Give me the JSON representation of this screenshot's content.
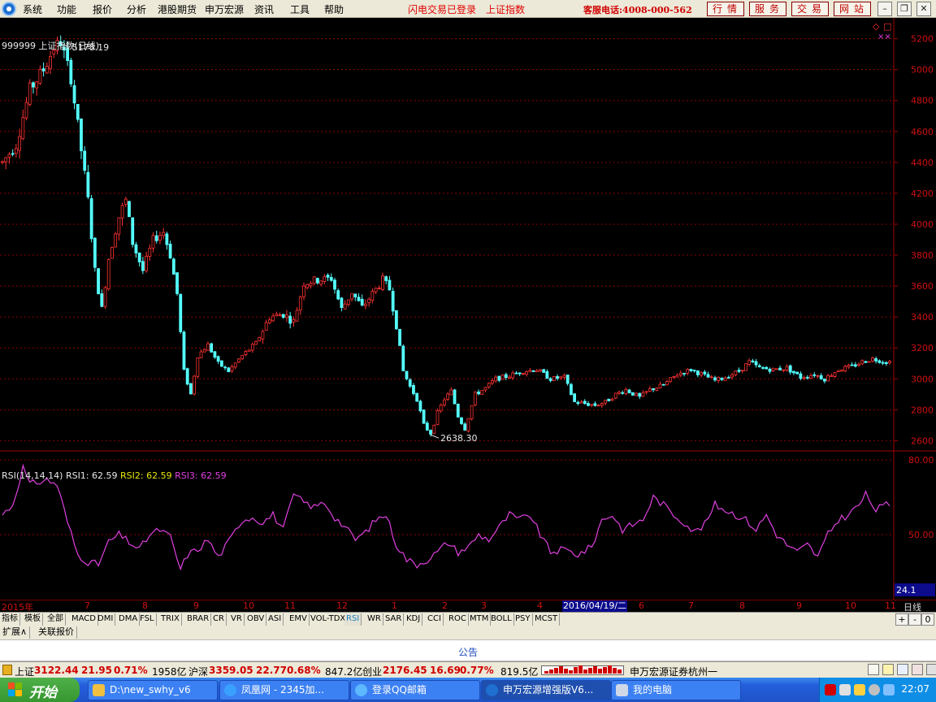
{
  "menu": {
    "items": [
      "系统",
      "功能",
      "报价",
      "分析",
      "港股期货",
      "申万宏源",
      "资讯",
      "工具",
      "帮助"
    ],
    "flash_status": "闪电交易已登录",
    "index_link": "上证指数",
    "service_phone": "客服电话:4008-000-562",
    "buttons": [
      "行情",
      "服务",
      "交易",
      "网站"
    ]
  },
  "chart": {
    "title": "999999 上证指数(日线)",
    "high_label": "5178.19",
    "low_label": "2638.30",
    "rsi_header": {
      "name": "RSI(14,14,14)",
      "rsi1": "RSI1: 62.59",
      "rsi2": "RSI2: 62.59",
      "rsi3": "RSI3: 62.59"
    }
  },
  "chart_data": {
    "type": "candlestick",
    "title": "999999 上证指数(日线)",
    "price_axis": {
      "ticks": [
        5200,
        5000,
        4800,
        4600,
        4400,
        4200,
        4000,
        3800,
        3600,
        3400,
        3200,
        3000,
        2800,
        2600
      ],
      "ylim": [
        2560,
        5240
      ]
    },
    "rsi_axis": {
      "ticks": [
        80,
        50
      ],
      "labels": [
        "80.00",
        "50.00"
      ],
      "current": "24.1"
    },
    "time_axis": {
      "labels": [
        "2015年",
        "7",
        "8",
        "9",
        "10",
        "11",
        "12",
        "1",
        "2",
        "3",
        "4",
        "6",
        "7",
        "8",
        "9",
        "10",
        "11"
      ],
      "cursor_date": "2016/04/19/二",
      "period": "日线"
    },
    "price_path": [
      {
        "i": 0,
        "v": 4400
      },
      {
        "i": 4,
        "v": 4520
      },
      {
        "i": 8,
        "v": 4870
      },
      {
        "i": 12,
        "v": 5000
      },
      {
        "i": 15,
        "v": 5140
      },
      {
        "i": 17,
        "v": 5178
      },
      {
        "i": 20,
        "v": 4950
      },
      {
        "i": 23,
        "v": 4480
      },
      {
        "i": 25,
        "v": 4150
      },
      {
        "i": 27,
        "v": 3700
      },
      {
        "i": 29,
        "v": 3450
      },
      {
        "i": 31,
        "v": 3780
      },
      {
        "i": 34,
        "v": 4050
      },
      {
        "i": 36,
        "v": 4150
      },
      {
        "i": 38,
        "v": 3880
      },
      {
        "i": 41,
        "v": 3700
      },
      {
        "i": 44,
        "v": 3900
      },
      {
        "i": 47,
        "v": 3950
      },
      {
        "i": 49,
        "v": 3800
      },
      {
        "i": 51,
        "v": 3550
      },
      {
        "i": 53,
        "v": 3050
      },
      {
        "i": 55,
        "v": 2900
      },
      {
        "i": 57,
        "v": 3150
      },
      {
        "i": 60,
        "v": 3220
      },
      {
        "i": 63,
        "v": 3100
      },
      {
        "i": 66,
        "v": 3050
      },
      {
        "i": 70,
        "v": 3150
      },
      {
        "i": 74,
        "v": 3230
      },
      {
        "i": 78,
        "v": 3400
      },
      {
        "i": 82,
        "v": 3420
      },
      {
        "i": 85,
        "v": 3370
      },
      {
        "i": 88,
        "v": 3620
      },
      {
        "i": 92,
        "v": 3640
      },
      {
        "i": 96,
        "v": 3650
      },
      {
        "i": 99,
        "v": 3450
      },
      {
        "i": 102,
        "v": 3560
      },
      {
        "i": 105,
        "v": 3460
      },
      {
        "i": 108,
        "v": 3550
      },
      {
        "i": 111,
        "v": 3640
      },
      {
        "i": 113,
        "v": 3580
      },
      {
        "i": 115,
        "v": 3350
      },
      {
        "i": 117,
        "v": 3050
      },
      {
        "i": 119,
        "v": 2950
      },
      {
        "i": 121,
        "v": 2870
      },
      {
        "i": 123,
        "v": 2700
      },
      {
        "i": 125,
        "v": 2650
      },
      {
        "i": 127,
        "v": 2780
      },
      {
        "i": 129,
        "v": 2870
      },
      {
        "i": 131,
        "v": 2920
      },
      {
        "i": 133,
        "v": 2760
      },
      {
        "i": 135,
        "v": 2680
      },
      {
        "i": 138,
        "v": 2900
      },
      {
        "i": 141,
        "v": 2940
      },
      {
        "i": 144,
        "v": 3000
      },
      {
        "i": 148,
        "v": 3020
      },
      {
        "i": 152,
        "v": 3050
      },
      {
        "i": 156,
        "v": 3060
      },
      {
        "i": 160,
        "v": 3000
      },
      {
        "i": 164,
        "v": 3010
      },
      {
        "i": 167,
        "v": 2850
      },
      {
        "i": 170,
        "v": 2840
      },
      {
        "i": 173,
        "v": 2830
      },
      {
        "i": 176,
        "v": 2850
      },
      {
        "i": 179,
        "v": 2900
      },
      {
        "i": 182,
        "v": 2930
      },
      {
        "i": 186,
        "v": 2880
      },
      {
        "i": 189,
        "v": 2930
      },
      {
        "i": 193,
        "v": 2960
      },
      {
        "i": 197,
        "v": 3030
      },
      {
        "i": 201,
        "v": 3060
      },
      {
        "i": 205,
        "v": 3020
      },
      {
        "i": 208,
        "v": 2990
      },
      {
        "i": 211,
        "v": 3010
      },
      {
        "i": 215,
        "v": 3050
      },
      {
        "i": 218,
        "v": 3110
      },
      {
        "i": 221,
        "v": 3070
      },
      {
        "i": 225,
        "v": 3060
      },
      {
        "i": 229,
        "v": 3070
      },
      {
        "i": 233,
        "v": 3010
      },
      {
        "i": 237,
        "v": 3030
      },
      {
        "i": 240,
        "v": 3000
      },
      {
        "i": 244,
        "v": 3060
      },
      {
        "i": 248,
        "v": 3080
      },
      {
        "i": 251,
        "v": 3110
      },
      {
        "i": 254,
        "v": 3130
      },
      {
        "i": 256,
        "v": 3120
      },
      {
        "i": 258,
        "v": 3110
      }
    ],
    "rsi_path": [
      {
        "i": 0,
        "v": 58
      },
      {
        "i": 3,
        "v": 62
      },
      {
        "i": 6,
        "v": 77
      },
      {
        "i": 8,
        "v": 70
      },
      {
        "i": 10,
        "v": 71
      },
      {
        "i": 13,
        "v": 72
      },
      {
        "i": 16,
        "v": 70
      },
      {
        "i": 19,
        "v": 55
      },
      {
        "i": 22,
        "v": 42
      },
      {
        "i": 25,
        "v": 39
      },
      {
        "i": 28,
        "v": 38
      },
      {
        "i": 31,
        "v": 47
      },
      {
        "i": 34,
        "v": 50
      },
      {
        "i": 37,
        "v": 47
      },
      {
        "i": 40,
        "v": 44
      },
      {
        "i": 43,
        "v": 50
      },
      {
        "i": 46,
        "v": 52
      },
      {
        "i": 49,
        "v": 49
      },
      {
        "i": 52,
        "v": 36
      },
      {
        "i": 54,
        "v": 42
      },
      {
        "i": 57,
        "v": 44
      },
      {
        "i": 60,
        "v": 48
      },
      {
        "i": 63,
        "v": 41
      },
      {
        "i": 66,
        "v": 47
      },
      {
        "i": 70,
        "v": 56
      },
      {
        "i": 73,
        "v": 57
      },
      {
        "i": 76,
        "v": 55
      },
      {
        "i": 79,
        "v": 58
      },
      {
        "i": 82,
        "v": 52
      },
      {
        "i": 85,
        "v": 66
      },
      {
        "i": 88,
        "v": 63
      },
      {
        "i": 91,
        "v": 61
      },
      {
        "i": 94,
        "v": 63
      },
      {
        "i": 97,
        "v": 57
      },
      {
        "i": 100,
        "v": 53
      },
      {
        "i": 103,
        "v": 48
      },
      {
        "i": 106,
        "v": 51
      },
      {
        "i": 109,
        "v": 56
      },
      {
        "i": 112,
        "v": 58
      },
      {
        "i": 115,
        "v": 46
      },
      {
        "i": 118,
        "v": 40
      },
      {
        "i": 121,
        "v": 38
      },
      {
        "i": 124,
        "v": 40
      },
      {
        "i": 127,
        "v": 43
      },
      {
        "i": 130,
        "v": 47
      },
      {
        "i": 133,
        "v": 43
      },
      {
        "i": 136,
        "v": 45
      },
      {
        "i": 139,
        "v": 50
      },
      {
        "i": 142,
        "v": 48
      },
      {
        "i": 145,
        "v": 53
      },
      {
        "i": 148,
        "v": 58
      },
      {
        "i": 151,
        "v": 56
      },
      {
        "i": 154,
        "v": 58
      },
      {
        "i": 157,
        "v": 50
      },
      {
        "i": 160,
        "v": 43
      },
      {
        "i": 164,
        "v": 44
      },
      {
        "i": 168,
        "v": 42
      },
      {
        "i": 172,
        "v": 45
      },
      {
        "i": 175,
        "v": 56
      },
      {
        "i": 178,
        "v": 58
      },
      {
        "i": 181,
        "v": 52
      },
      {
        "i": 184,
        "v": 54
      },
      {
        "i": 187,
        "v": 56
      },
      {
        "i": 190,
        "v": 65
      },
      {
        "i": 193,
        "v": 62
      },
      {
        "i": 196,
        "v": 58
      },
      {
        "i": 199,
        "v": 55
      },
      {
        "i": 202,
        "v": 51
      },
      {
        "i": 205,
        "v": 54
      },
      {
        "i": 208,
        "v": 62
      },
      {
        "i": 211,
        "v": 60
      },
      {
        "i": 214,
        "v": 58
      },
      {
        "i": 217,
        "v": 56
      },
      {
        "i": 220,
        "v": 52
      },
      {
        "i": 223,
        "v": 58
      },
      {
        "i": 226,
        "v": 50
      },
      {
        "i": 229,
        "v": 46
      },
      {
        "i": 232,
        "v": 43
      },
      {
        "i": 235,
        "v": 46
      },
      {
        "i": 238,
        "v": 41
      },
      {
        "i": 241,
        "v": 50
      },
      {
        "i": 244,
        "v": 56
      },
      {
        "i": 247,
        "v": 58
      },
      {
        "i": 250,
        "v": 62
      },
      {
        "i": 252,
        "v": 66
      },
      {
        "i": 255,
        "v": 60
      },
      {
        "i": 258,
        "v": 62
      }
    ]
  },
  "indicator_tabs": [
    "指标",
    "模板",
    "全部",
    "MACD",
    "DMI",
    "DMA",
    "FSL",
    "TRIX",
    "BRAR",
    "CR",
    "VR",
    "OBV",
    "ASI",
    "EMV",
    "VOL-TDX",
    "RSI",
    "WR",
    "SAR",
    "KDJ",
    "CCI",
    "ROC",
    "MTM",
    "BOLL",
    "PSY",
    "MCST"
  ],
  "active_indicator": "RSI",
  "tab_controls": [
    "+",
    "-",
    "0"
  ],
  "ext_tabs": [
    "扩展∧",
    "关联报价"
  ],
  "notice": "公告",
  "status": {
    "sh_label": "上证",
    "sh_value": "3122.44",
    "sh_change": "21.95",
    "sh_pct": "0.71%",
    "sh_amount": "1958亿",
    "sz_label": "沪深",
    "sz_value": "3359.05",
    "sz_change": "22.77",
    "sz_pct": "0.68%",
    "sz_amount": "847.2亿",
    "cy_label": "创业",
    "cy_value": "2176.45",
    "cy_change": "16.69",
    "cy_pct": "0.77%",
    "cy_amount": "819.5亿",
    "broker": "申万宏源证券杭州一"
  },
  "taskbar": {
    "start": "开始",
    "tasks": [
      "D:\\new_swhy_v6",
      "凤凰网 - 2345加...",
      "登录QQ邮箱",
      "申万宏源增强版V6...",
      "我的电脑"
    ],
    "clock": "22:07"
  },
  "colors": {
    "up": "#ff3232",
    "down": "#54ffff",
    "rsi": "#e040e0",
    "grid": "#8a0000",
    "axis_text": "#d01010"
  }
}
